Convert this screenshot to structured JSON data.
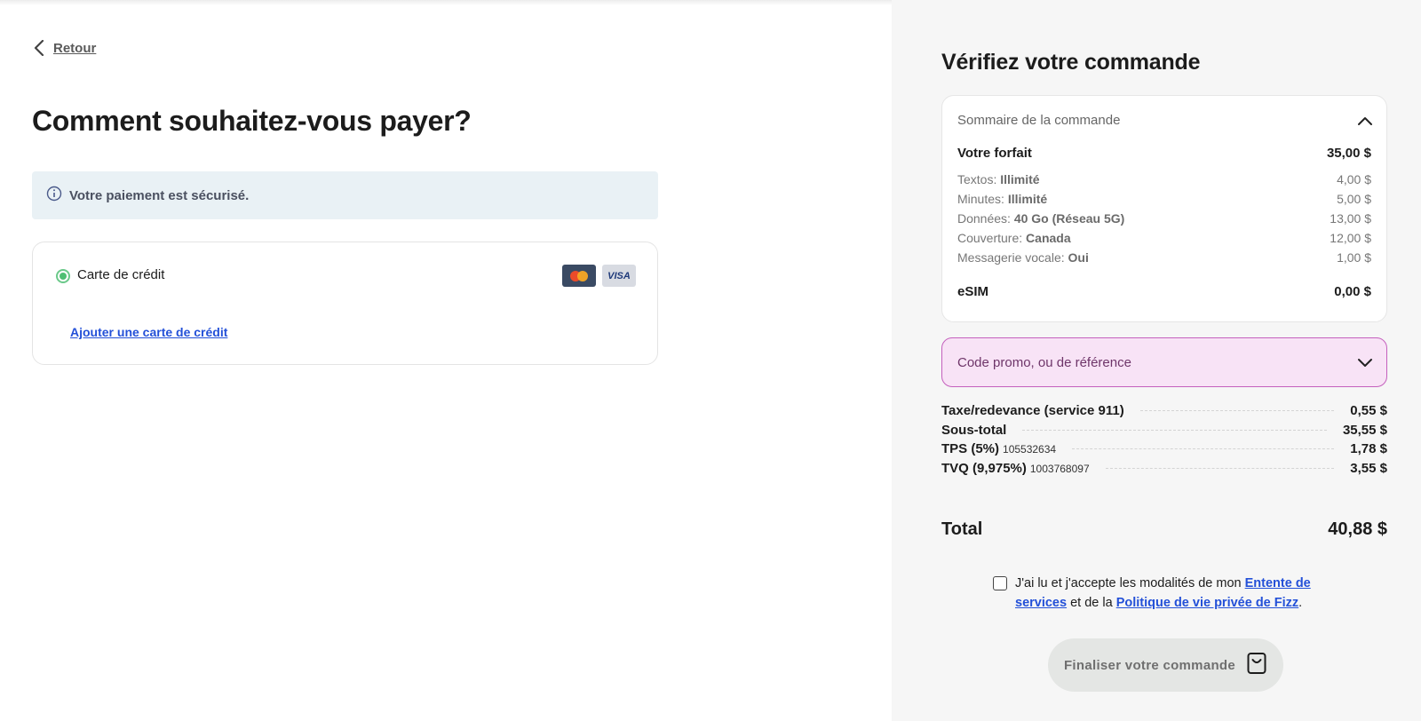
{
  "nav": {
    "back_label": "Retour"
  },
  "payment": {
    "title": "Comment souhaitez-vous payer?",
    "secure_notice": "Votre paiement est sécurisé.",
    "method_label": "Carte de crédit",
    "card_brands": [
      "mastercard",
      "VISA"
    ],
    "add_card_link": "Ajouter une carte de crédit"
  },
  "review": {
    "title": "Vérifiez votre commande",
    "summary_header": "Sommaire de la commande",
    "plan": {
      "label": "Votre forfait",
      "price": "35,00 $"
    },
    "items": [
      {
        "label": "Textos: ",
        "value": "Illimité",
        "price": "4,00 $"
      },
      {
        "label": "Minutes: ",
        "value": "Illimité",
        "price": "5,00 $"
      },
      {
        "label": "Données: ",
        "value": "40 Go (Réseau 5G)",
        "price": "13,00 $"
      },
      {
        "label": "Couverture: ",
        "value": "Canada",
        "price": "12,00 $"
      },
      {
        "label": "Messagerie vocale: ",
        "value": "Oui",
        "price": "1,00 $"
      }
    ],
    "esim": {
      "label": "eSIM",
      "price": "0,00 $"
    },
    "promo_label": "Code promo, ou de référence",
    "fees": [
      {
        "name": "Taxe/redevance (service 911)",
        "number": "",
        "amount": "0,55 $"
      },
      {
        "name": "Sous-total",
        "number": "",
        "amount": "35,55 $"
      },
      {
        "name": "TPS (5%)",
        "number": "105532634",
        "amount": "1,78 $"
      },
      {
        "name": "TVQ (9,975%)",
        "number": "1003768097",
        "amount": "3,55 $"
      }
    ],
    "total_label": "Total",
    "total_amount": "40,88 $",
    "agreement": {
      "prefix": "J'ai lu et j'accepte les modalités de mon ",
      "link1": "Entente de services",
      "middle": " et de la ",
      "link2": "Politique de vie privée de Fizz",
      "suffix": "."
    },
    "finalize_label": "Finaliser votre commande"
  },
  "colors": {
    "accent_link": "#2350d8",
    "radio_green": "#4fbf73",
    "promo_bg": "#f8e3f6",
    "promo_border": "#c460bd",
    "secure_bg": "#e9f1f5"
  },
  "icons": [
    "chevron-left-icon",
    "info-icon",
    "chevron-up-icon",
    "chevron-down-icon",
    "shopping-bag-icon"
  ]
}
